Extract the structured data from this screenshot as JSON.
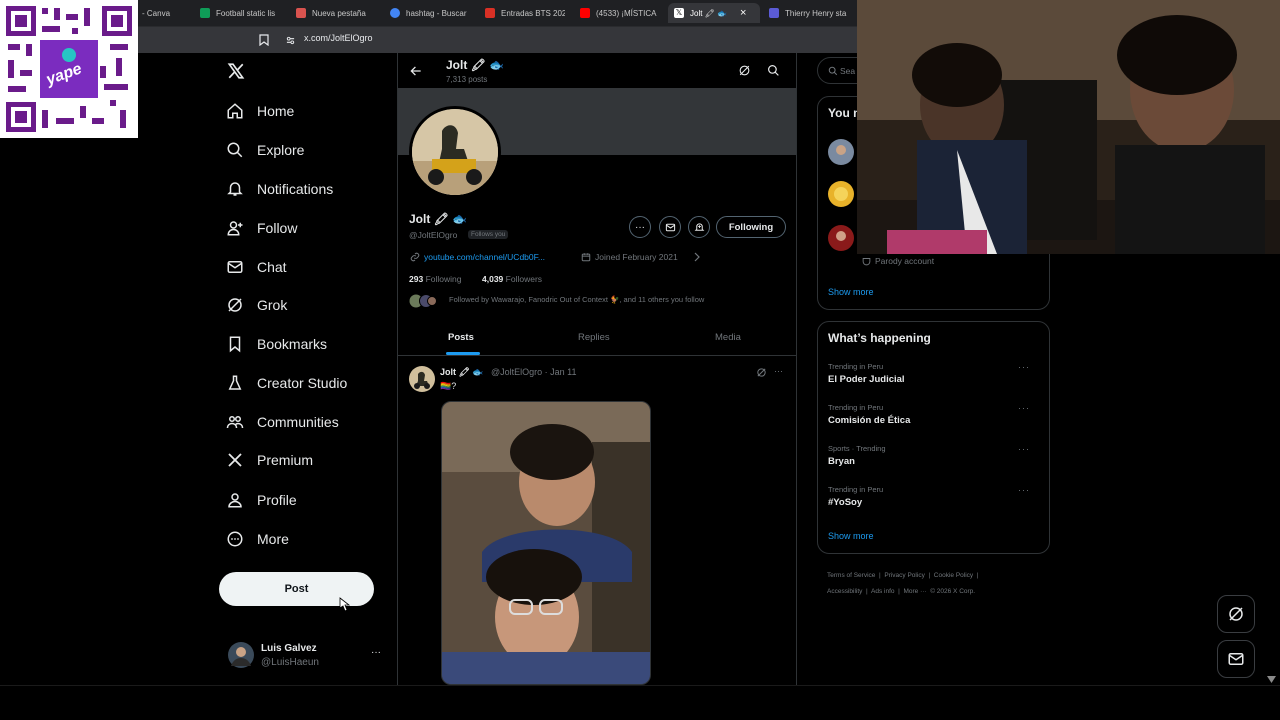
{
  "browser": {
    "tabs": [
      {
        "label": "- Canva",
        "color": "#7d2ae8"
      },
      {
        "label": "Football static lis",
        "color": "#0f9d58"
      },
      {
        "label": "Nueva pestaña",
        "color": "#d9534f"
      },
      {
        "label": "hashtag - Buscar",
        "color": "#4285f4"
      },
      {
        "label": "Entradas BTS 202",
        "color": "#d93025"
      },
      {
        "label": "(4533) ¡MÍSTICA",
        "color": "#ff0000"
      },
      {
        "label": "Jolt 🖍 🐟",
        "color": "#ffffff"
      },
      {
        "label": "Thierry Henry sta",
        "color": "#5b5bd6"
      }
    ],
    "close_glyph": "×",
    "url": "x.com/JoltElOgro"
  },
  "overlay": {
    "yape_label": "yape"
  },
  "sidebar": {
    "items": [
      {
        "label": "Home",
        "icon": "home-icon"
      },
      {
        "label": "Explore",
        "icon": "search-icon"
      },
      {
        "label": "Notifications",
        "icon": "bell-icon"
      },
      {
        "label": "Follow",
        "icon": "person-add-icon"
      },
      {
        "label": "Chat",
        "icon": "mail-icon"
      },
      {
        "label": "Grok",
        "icon": "grok-icon"
      },
      {
        "label": "Bookmarks",
        "icon": "bookmark-icon"
      },
      {
        "label": "Creator Studio",
        "icon": "flask-icon"
      },
      {
        "label": "Communities",
        "icon": "people-icon"
      },
      {
        "label": "Premium",
        "icon": "x-icon"
      },
      {
        "label": "Profile",
        "icon": "person-icon"
      },
      {
        "label": "More",
        "icon": "more-circle-icon"
      }
    ],
    "post_label": "Post",
    "account": {
      "name": "Luis Galvez",
      "handle": "@LuisHaeun",
      "more": "···"
    }
  },
  "profile": {
    "header_name": "Jolt 🖍 🐟",
    "post_count": "7,313 posts",
    "name": "Jolt 🖍 🐟",
    "handle": "@JoltElOgro",
    "follows_you": "Follows you",
    "link": "youtube.com/channel/UCdb0F...",
    "joined": "Joined February 2021",
    "following_count": "293",
    "following_label": "Following",
    "followers_count": "4,039",
    "followers_label": "Followers",
    "followed_by": "Followed by Wawarajo, Fanodric Out of Context 🐓, and 11 others you follow",
    "following_button": "Following",
    "more_button": "···",
    "tabs": [
      "Posts",
      "Replies",
      "Media"
    ]
  },
  "tweet": {
    "name": "Jolt 🖍 🐟",
    "meta": "@JoltElOgro · Jan 11",
    "text": "🏳️‍🌈?",
    "more": "···"
  },
  "right": {
    "search_placeholder": "Sea",
    "you_might_like": "You m",
    "parody": "Parody account",
    "show_more_1": "Show more",
    "happening_title": "What’s happening",
    "trends": [
      {
        "context": "Trending in Peru",
        "name": "El Poder Judicial"
      },
      {
        "context": "Trending in Peru",
        "name": "Comisión de Ética"
      },
      {
        "context": "Sports · Trending",
        "name": "Bryan"
      },
      {
        "context": "Trending in Peru",
        "name": "#YoSoy"
      }
    ],
    "show_more_2": "Show more",
    "footer": {
      "line1": [
        "Terms of Service",
        "|",
        "Privacy Policy",
        "|",
        "Cookie Policy",
        "|"
      ],
      "line2": [
        "Accessibility",
        "|",
        "Ads info",
        "|",
        "More ···",
        "© 2026 X Corp."
      ]
    }
  }
}
